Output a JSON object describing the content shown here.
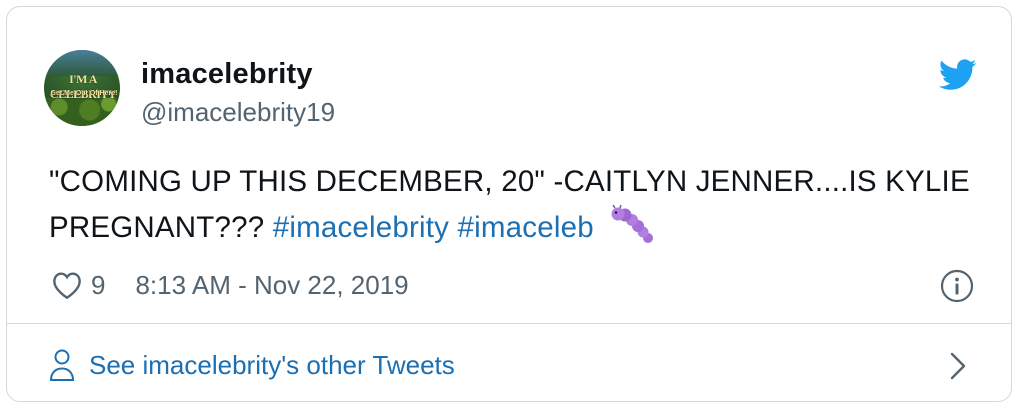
{
  "tweet": {
    "display_name": "imacelebrity",
    "handle": "@imacelebrity19",
    "avatar_text_line1": "I'M A CELEBRITY",
    "avatar_text_line2": "Get Me Out Of Here!",
    "text_main": "\"COMING UP THIS DECEMBER, 20\" -CAITLYN JENNER....IS KYLIE PREGNANT???",
    "hashtags": [
      "#imacelebrity",
      "#imaceleb"
    ],
    "emoji": "caterpillar-emoji",
    "likes": "9",
    "timestamp": "8:13 AM - Nov 22, 2019"
  },
  "footer": {
    "link_label": "See imacelebrity's other Tweets"
  },
  "colors": {
    "text": "#0f1419",
    "secondary": "#536471",
    "link": "#1b6fb3",
    "twitter_blue": "#1da1f2",
    "border": "#cfd9de"
  },
  "icons": [
    "twitter-bird-icon",
    "heart-icon",
    "info-icon",
    "person-icon",
    "chevron-right-icon"
  ]
}
